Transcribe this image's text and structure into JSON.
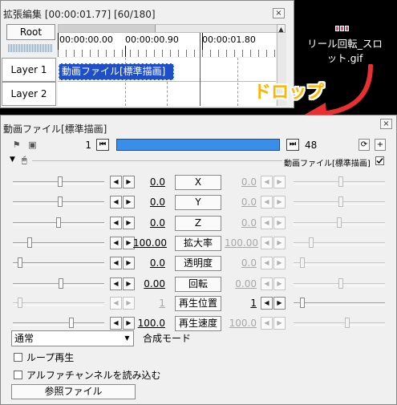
{
  "timeline": {
    "title": "拡張編集 [00:00:01.77] [60/180]",
    "close": "×",
    "root_label": "Root",
    "times": [
      "00:00:00.00",
      "00:00:00.90",
      "00:00:01.80"
    ],
    "layers": [
      "Layer 1",
      "Layer 2"
    ],
    "clip_label": "動画ファイル[標準描画]"
  },
  "desktop": {
    "gif_filename_line1": "リール回転_スロ",
    "gif_filename_line2": "ット.gif",
    "drop_label": "ドロップ",
    "accent_color": "#e83030"
  },
  "properties": {
    "title": "動画ファイル[標準描画]",
    "close": "×",
    "frame_start": "1",
    "frame_end": "48",
    "prev_frame_icon": "⏮",
    "next_frame_icon": "⏭",
    "frame_bar_color": "#3a8ee8",
    "object_label": "動画ファイル[標準描画]",
    "rows": [
      {
        "name": "X",
        "start": "0.0",
        "end": "0.0",
        "start_dis": false,
        "end_dis": true
      },
      {
        "name": "Y",
        "start": "0.0",
        "end": "0.0",
        "start_dis": false,
        "end_dis": true
      },
      {
        "name": "Z",
        "start": "0.0",
        "end": "0.0",
        "start_dis": false,
        "end_dis": true
      },
      {
        "name": "拡大率",
        "start": "100.00",
        "end": "100.00",
        "start_dis": false,
        "end_dis": true
      },
      {
        "name": "透明度",
        "start": "0.0",
        "end": "0.0",
        "start_dis": false,
        "end_dis": true
      },
      {
        "name": "回転",
        "start": "0.00",
        "end": "0.00",
        "start_dis": false,
        "end_dis": true
      },
      {
        "name": "再生位置",
        "start": "1",
        "end": "1",
        "start_dis": true,
        "end_dis": false
      },
      {
        "name": "再生速度",
        "start": "100.0",
        "end": "100.0",
        "start_dis": false,
        "end_dis": true
      }
    ],
    "blend_mode": "通常",
    "blend_label": "合成モード",
    "loop_label": "ループ再生",
    "alpha_label": "アルファチャンネルを読み込む",
    "ref_file_label": "参照ファイル"
  }
}
